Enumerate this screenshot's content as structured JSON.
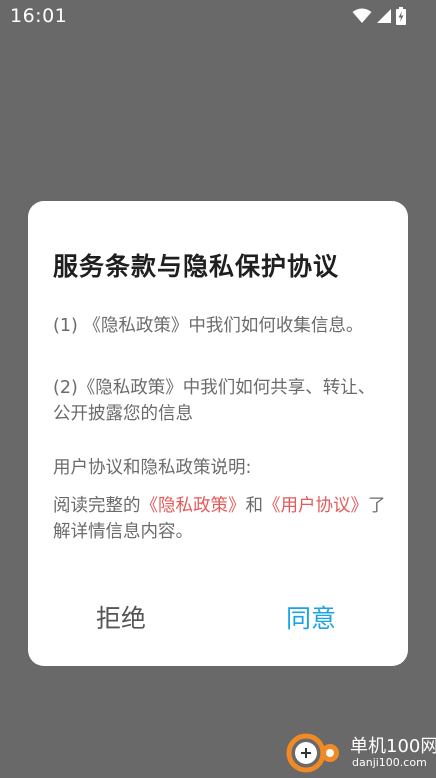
{
  "status_bar": {
    "time": "16:01",
    "icons": [
      "wifi-icon",
      "cellular-signal-icon",
      "battery-charging-icon"
    ]
  },
  "dialog": {
    "title": "服务条款与隐私保护协议",
    "p1": "(1) 《隐私政策》中我们如何收集信息。",
    "p2": "(2)《隐私政策》中我们如何共享、转让、公开披露您的信息",
    "p3": "用户协议和隐私政策说明:",
    "p4_prefix": "阅读完整的",
    "p4_link_privacy": "《隐私政策》",
    "p4_and": "和",
    "p4_link_terms": "《用户协议》",
    "p4_suffix": "了解详情信息内容。",
    "reject_label": "拒绝",
    "agree_label": "同意"
  },
  "watermark": {
    "name": "单机100网",
    "domain": "danji100.com"
  },
  "colors": {
    "overlay": "#696969",
    "link": "#e55a5a",
    "agree": "#1aa3e8",
    "reject": "#555555"
  }
}
